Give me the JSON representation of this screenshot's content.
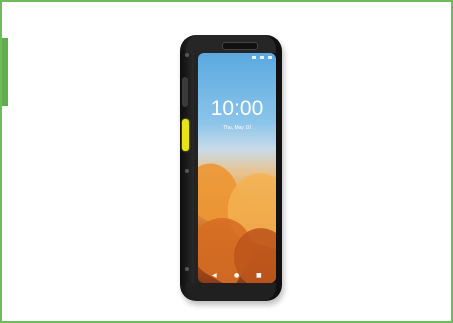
{
  "colors": {
    "frame_border": "#6fba5a",
    "left_tab": "#5fae4a",
    "device_body": "#1b1b1b",
    "scan_button": "#e8e41a"
  },
  "phone": {
    "lock_screen": {
      "time": "10:00",
      "date": "Thu, May 10"
    },
    "nav_bar": {
      "back_icon": "◀",
      "home_icon": "●",
      "recents_icon": "■"
    }
  }
}
